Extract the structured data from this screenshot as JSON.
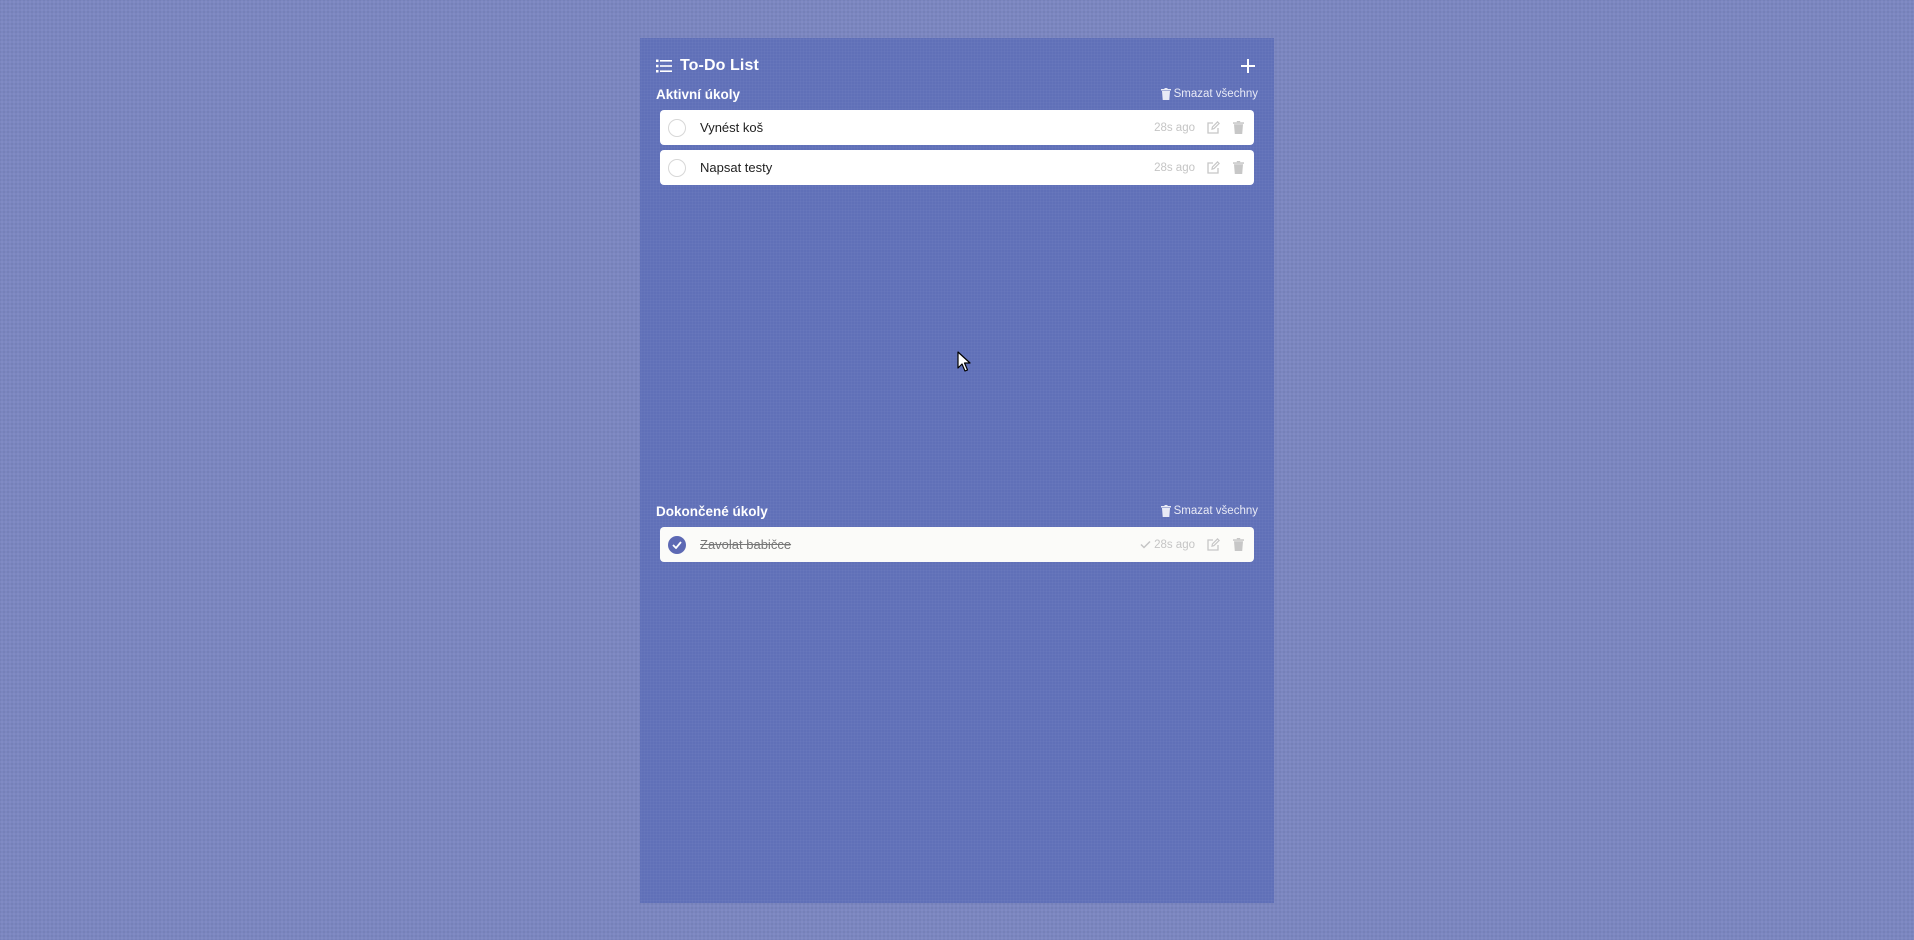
{
  "app": {
    "title": "To-Do List",
    "add_icon": "plus-icon",
    "list_icon": "list-icon"
  },
  "active": {
    "heading": "Aktivní úkoly",
    "clear_label": "Smazat všechny",
    "tasks": [
      {
        "text": "Vynést koš",
        "time": "28s ago",
        "done": false
      },
      {
        "text": "Napsat testy",
        "time": "28s ago",
        "done": false
      }
    ]
  },
  "completed": {
    "heading": "Dokončené úkoly",
    "clear_label": "Smazat všechny",
    "tasks": [
      {
        "text": "Zavolat babičce",
        "time": "28s ago",
        "done": true
      }
    ]
  },
  "colors": {
    "page_background": "#7b86c0",
    "panel_background": "#6070b8",
    "accent": "#5d69b4",
    "task_background": "#ffffff"
  }
}
